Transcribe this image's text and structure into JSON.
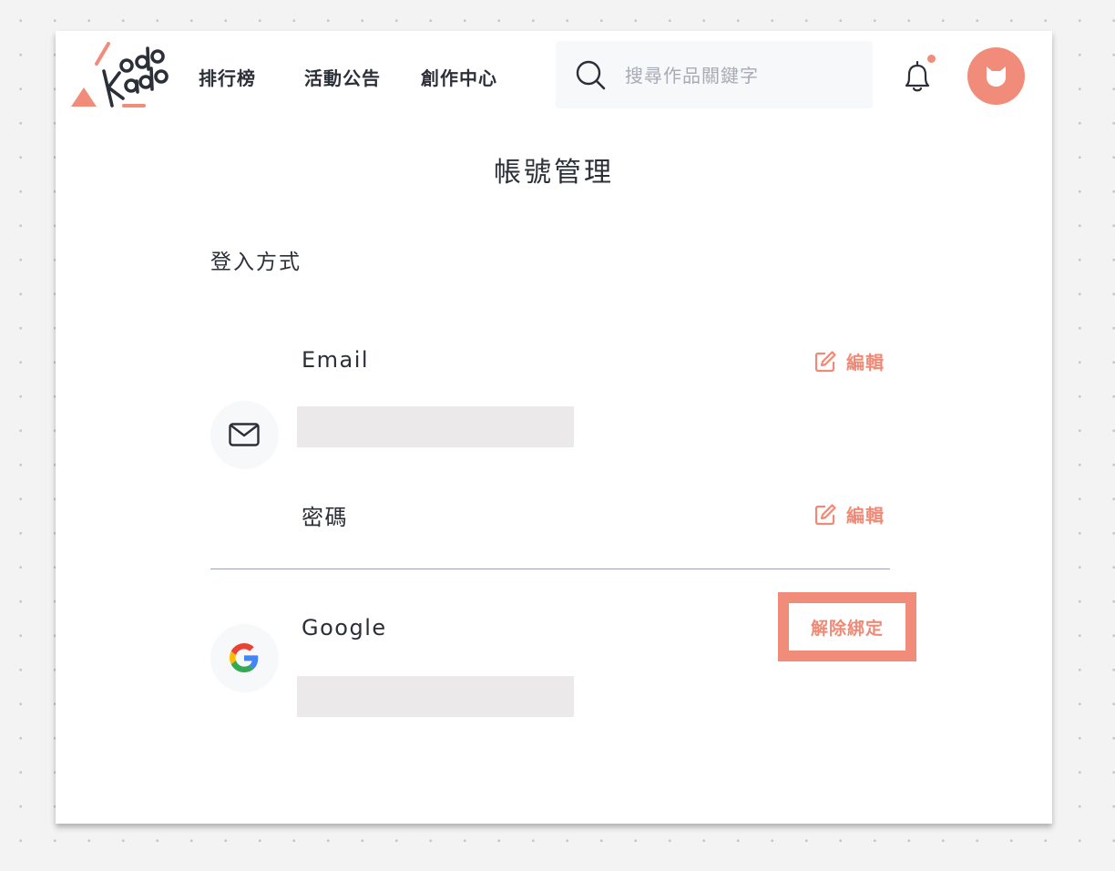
{
  "header": {
    "logo_text": "Kodo Kado",
    "nav": [
      "排行榜",
      "活動公告",
      "創作中心"
    ],
    "search": {
      "placeholder": "搜尋作品關鍵字",
      "value": ""
    },
    "notification": {
      "has_unread": true
    }
  },
  "page": {
    "title": "帳號管理",
    "section_title": "登入方式"
  },
  "login_methods": {
    "email": {
      "label": "Email",
      "icon": "mail-icon",
      "value": "",
      "edit_label": "編輯"
    },
    "password": {
      "label": "密碼",
      "edit_label": "編輯"
    },
    "google": {
      "label": "Google",
      "icon": "google-icon",
      "value": "",
      "action_label": "解除綁定"
    }
  },
  "colors": {
    "accent": "#f08c79",
    "text": "#2b2f38",
    "placeholder": "#a6abb5",
    "icon_bg": "#f7f8fa",
    "value_bar": "#ece9ea",
    "divider": "#99a4b0"
  }
}
